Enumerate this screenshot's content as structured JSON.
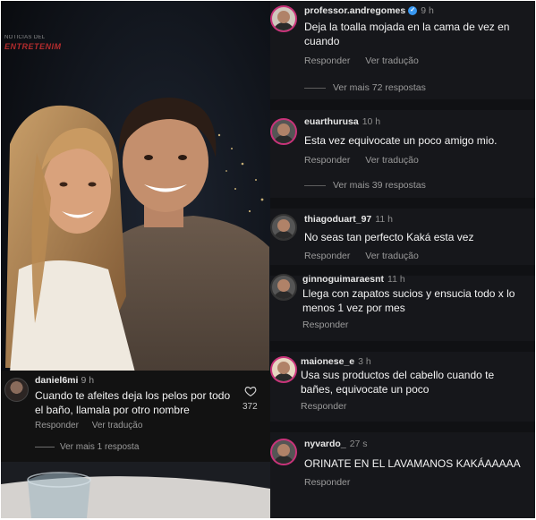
{
  "photo": {
    "watermark_small": "NOTICIAS DEL",
    "watermark_brand": "ENTRETENIM"
  },
  "overlay_comment": {
    "username": "daniel6mi",
    "time": "9 h",
    "text": "Cuando te afeites deja los pelos por todo el baño, llamala por otro nombre",
    "reply": "Responder",
    "translate": "Ver tradução",
    "likes": "372",
    "more": "Ver mais 1 resposta"
  },
  "comments": [
    {
      "username": "professor.andregomes",
      "verified": true,
      "time": "9 h",
      "text": "Deja la toalla mojada en la cama de vez en cuando",
      "reply": "Responder",
      "translate": "Ver tradução",
      "more": "Ver mais 72 respostas"
    },
    {
      "username": "euarthurusa",
      "time": "10 h",
      "text": "Esta vez equivocate un poco amigo mio.",
      "reply": "Responder",
      "translate": "Ver tradução",
      "more": "Ver mais 39 respostas"
    },
    {
      "username": "thiagoduart_97",
      "time": "11 h",
      "text": "No seas tan perfecto Kaká esta vez",
      "reply": "Responder",
      "translate": "Ver tradução"
    },
    {
      "username": "ginnoguimaraesnt",
      "time": "11 h",
      "text": "Llega con zapatos sucios y ensucia todo x lo menos 1 vez por mes",
      "reply": "Responder"
    },
    {
      "username": "maionese_e",
      "time": "3 h",
      "text": "Usa sus productos del cabello cuando te bañes, equivocate un poco",
      "reply": "Responder"
    },
    {
      "username": "nyvardo_",
      "time": "27 s",
      "text": "ORINATE EN EL LAVAMANOS KAKÁAAAAA",
      "reply": "Responder"
    }
  ],
  "colors": {
    "panel_bg": "#16171b",
    "story_ring": "#c9337a",
    "verified": "#3897f0",
    "muted_text": "#9b9b9b"
  },
  "icons": [
    "heart-icon",
    "verified-icon"
  ]
}
